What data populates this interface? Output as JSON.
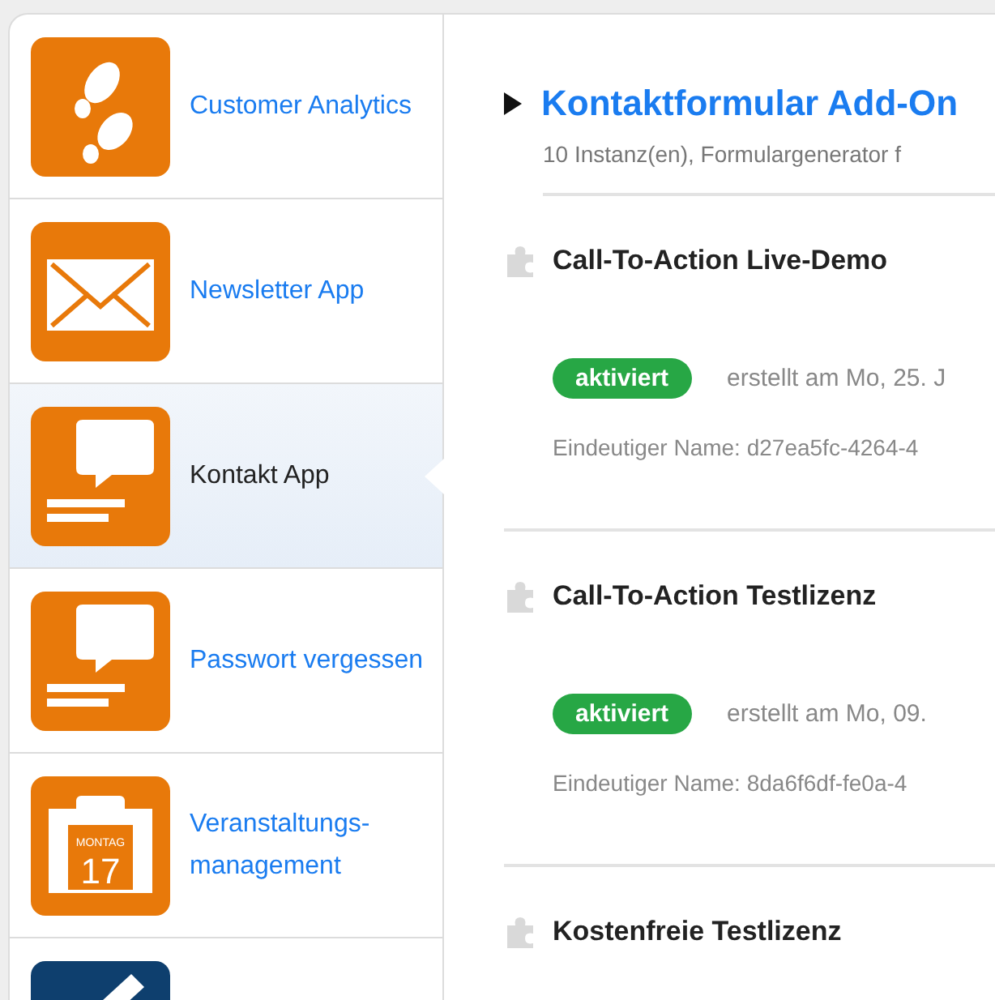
{
  "sidebar": {
    "items": [
      {
        "label": "Customer Analytics",
        "kind": "footprints",
        "color": "#e8790a",
        "selected": false
      },
      {
        "label": "Newsletter App",
        "kind": "envelope",
        "color": "#e8790a",
        "selected": false
      },
      {
        "label": "Kontakt  App",
        "kind": "speech",
        "color": "#e8790a",
        "selected": true
      },
      {
        "label": "Passwort vergessen",
        "kind": "speech",
        "color": "#e8790a",
        "selected": false
      },
      {
        "label": "Veranstaltungs-management",
        "kind": "calendar",
        "color": "#e8790a",
        "selected": false,
        "calendar_day": "MONTAG",
        "calendar_date": "17"
      },
      {
        "kind": "pen",
        "color": "#0e3f6e",
        "selected": false
      }
    ]
  },
  "main": {
    "title": "Kontaktformular Add-On",
    "subtitle": "10 Instanz(en), Formulargenerator f",
    "expanded": true,
    "instances": [
      {
        "name": "Call-To-Action Live-Demo",
        "status": "aktiviert",
        "active": true,
        "created": "erstellt am Mo, 25. J",
        "unique_name": "Eindeutiger Name: d27ea5fc-4264-4"
      },
      {
        "name": "Call-To-Action Testlizenz",
        "status": "aktiviert",
        "active": true,
        "created": "erstellt am Mo, 09.",
        "unique_name": "Eindeutiger Name: 8da6f6df-fe0a-4"
      },
      {
        "name": "Kostenfreie Testlizenz"
      }
    ]
  }
}
